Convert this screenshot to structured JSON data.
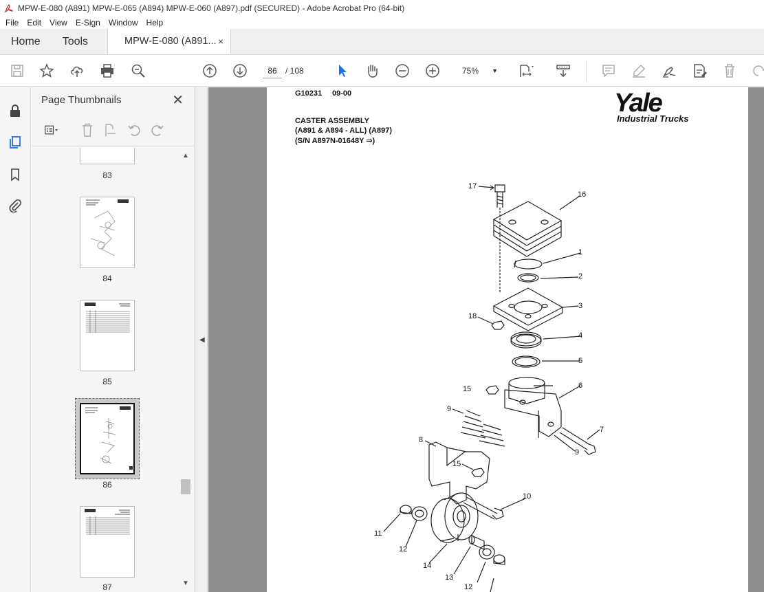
{
  "window": {
    "title": "MPW-E-080 (A891) MPW-E-065 (A894) MPW-E-060 (A897).pdf (SECURED) - Adobe Acrobat Pro (64-bit)"
  },
  "menu": [
    "File",
    "Edit",
    "View",
    "E-Sign",
    "Window",
    "Help"
  ],
  "tabs": {
    "home": "Home",
    "tools": "Tools",
    "doc": "MPW-E-080 (A891...",
    "close": "×"
  },
  "toolbar": {
    "current_page": "86",
    "total_pages": "/ 108",
    "zoom": "75%"
  },
  "panel": {
    "title": "Page Thumbnails",
    "close": "✕",
    "thumbnails": [
      {
        "label": "83"
      },
      {
        "label": "84"
      },
      {
        "label": "85"
      },
      {
        "label": "86",
        "selected": true
      },
      {
        "label": "87"
      }
    ]
  },
  "page": {
    "code": "G10231",
    "date": "09-00",
    "title_line1": "CASTER ASSEMBLY",
    "title_line2": "(A891 & A894 - ALL) (A897)",
    "title_line3": "(S/N A897N-01648Y ⇒)",
    "logo_brand": "Yale",
    "logo_sub": "Industrial Trucks",
    "callouts": [
      "17",
      "16",
      "1",
      "2",
      "3",
      "18",
      "4",
      "5",
      "15",
      "6",
      "9",
      "7",
      "8",
      "9",
      "15",
      "10",
      "11",
      "12",
      "14",
      "13",
      "12"
    ]
  }
}
